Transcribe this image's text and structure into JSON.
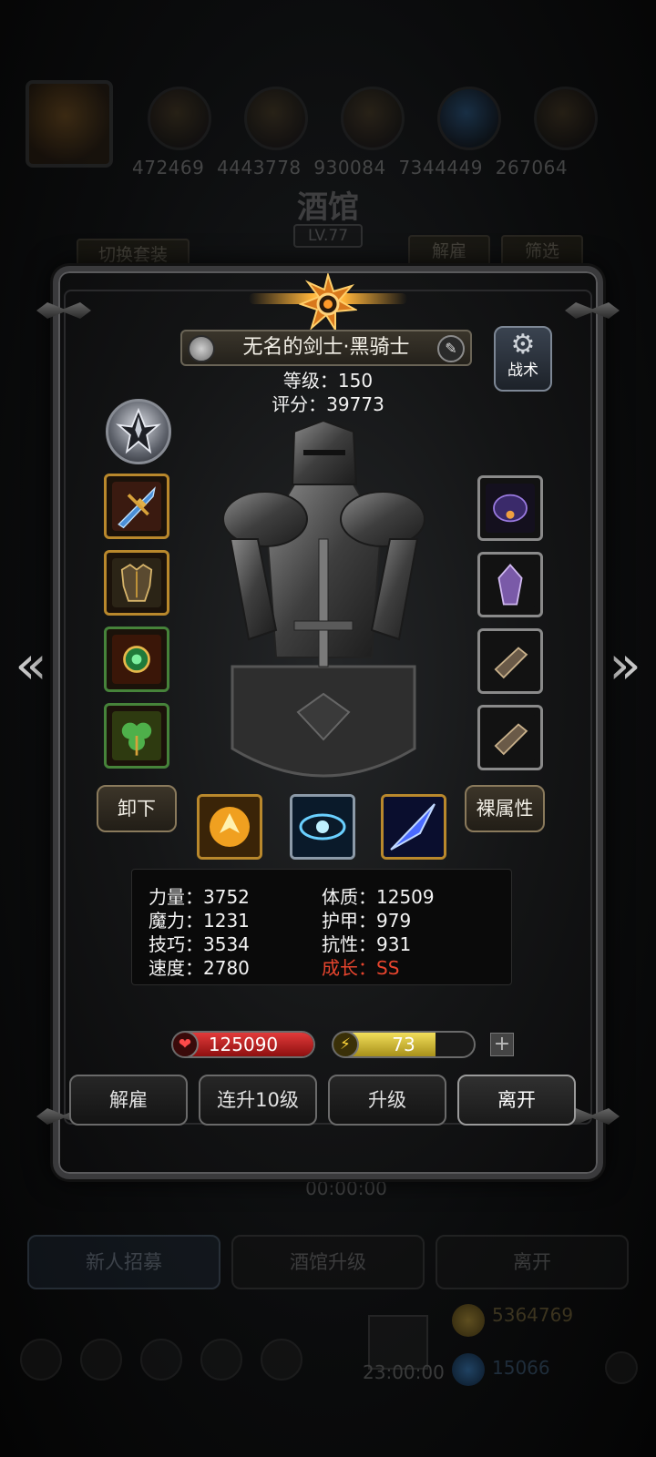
{
  "background": {
    "resources": [
      "472469",
      "4443778",
      "930084",
      "7344449",
      "267064"
    ],
    "title": "酒馆",
    "level": "LV.77",
    "switch_set_label": "切换套装",
    "dismiss_label": "解雇",
    "filter_label": "筛选",
    "timer": "00:00:00",
    "bottom_buttons": [
      "新人招募",
      "酒馆升级",
      "离开"
    ],
    "gold": "5364769",
    "gems": "15066",
    "chest_timer": "23:00:00"
  },
  "hero": {
    "name": "无名的剑士·黑骑士",
    "level_label": "等级：150",
    "score_label": "评分：39773",
    "tactics_label": "战术",
    "unequip_label": "卸下",
    "base_attr_label": "裸属性"
  },
  "stats": {
    "strength": "力量：3752",
    "magic": "魔力：1231",
    "skill": "技巧：3534",
    "speed": "速度：2780",
    "constitution": "体质：12509",
    "armor": "护甲：979",
    "resistance": "抗性：931",
    "growth": "成长：SS"
  },
  "bars": {
    "hp": "125090",
    "energy": "73",
    "energy_fill": 0.73
  },
  "actions": [
    "解雇",
    "连升10级",
    "升级",
    "离开"
  ],
  "icons": {
    "left_slots": [
      "sword-icon",
      "armor-icon",
      "amulet-icon",
      "clover-icon"
    ],
    "right_slots": [
      "shadow-helm-icon",
      "crystal-icon",
      "bracer-icon",
      "bracer-icon"
    ],
    "skills": [
      "fire-fist-icon",
      "eye-icon",
      "ice-blade-icon"
    ]
  },
  "colors": {
    "growth": "#e8452e",
    "hp": "#c81e1e",
    "energy": "#d8c23a",
    "gold_frame": "#b9882c"
  }
}
